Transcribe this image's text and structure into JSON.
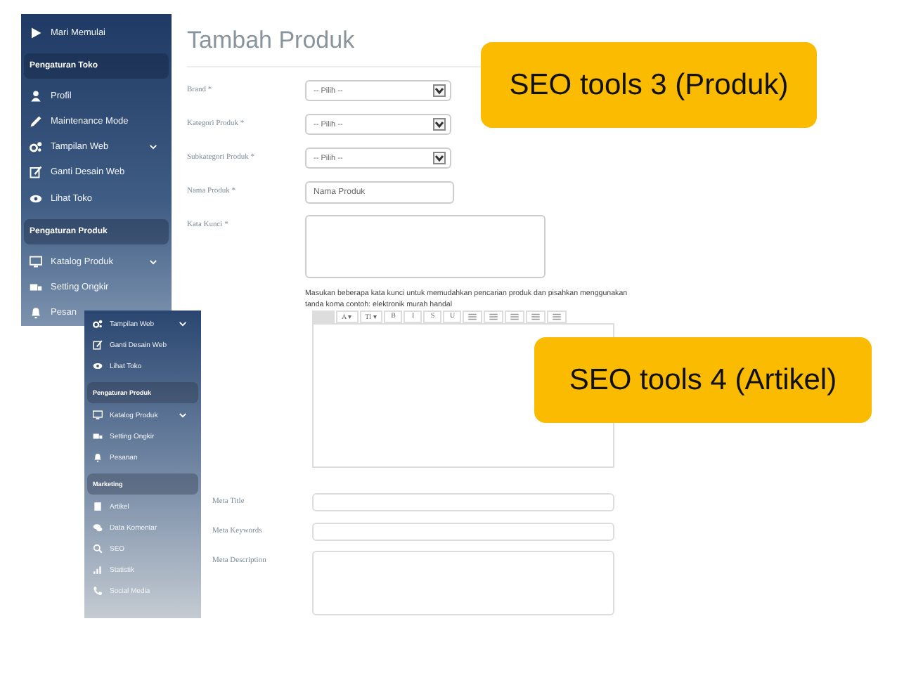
{
  "screens": [
    {
      "sidebar": {
        "items": [
          {
            "kind": "item",
            "label": "Mari Memulai",
            "has_submenu": false
          },
          {
            "kind": "section",
            "label": "Pengaturan Toko"
          },
          {
            "kind": "item",
            "label": "Profil",
            "has_submenu": false
          },
          {
            "kind": "item",
            "label": "Maintenance Mode",
            "has_submenu": false
          },
          {
            "kind": "item",
            "label": "Tampilan Web",
            "has_submenu": true
          },
          {
            "kind": "item",
            "label": "Ganti Desain Web",
            "has_submenu": false
          },
          {
            "kind": "item",
            "label": "Lihat Toko",
            "has_submenu": false
          },
          {
            "kind": "section",
            "label": "Pengaturan Produk"
          },
          {
            "kind": "item",
            "label": "Katalog Produk",
            "has_submenu": true
          },
          {
            "kind": "item",
            "label": "Setting Ongkir",
            "has_submenu": false
          },
          {
            "kind": "item",
            "label": "Pesan",
            "has_submenu": false
          }
        ]
      },
      "form": {
        "title": "Tambah Produk",
        "fields": [
          {
            "kind": "select",
            "label": "Brand *",
            "value": "-- Pilih --"
          },
          {
            "kind": "select",
            "label": "Kategori Produk *",
            "value": "-- Pilih --"
          },
          {
            "kind": "select",
            "label": "Subkategori Produk *",
            "value": "-- Pilih --"
          },
          {
            "kind": "text",
            "label": "Nama Produk *",
            "placeholder": "Nama Produk"
          },
          {
            "kind": "textarea",
            "label": "Kata Kunci *",
            "help": [
              "Masukan beberapa kata kunci untuk memudahkan pencarian produk dan pisahkan menggunakan",
              "tanda koma contoh: elektronik murah handal"
            ]
          }
        ]
      }
    },
    {
      "sidebar": {
        "items": [
          {
            "kind": "item",
            "label": "Tampilan Web",
            "has_submenu": true
          },
          {
            "kind": "item",
            "label": "Ganti Desain Web",
            "has_submenu": false
          },
          {
            "kind": "item",
            "label": "Lihat Toko",
            "has_submenu": false
          },
          {
            "kind": "section",
            "label": "Pengaturan Produk"
          },
          {
            "kind": "item",
            "label": "Katalog Produk",
            "has_submenu": true
          },
          {
            "kind": "item",
            "label": "Setting Ongkir",
            "has_submenu": false
          },
          {
            "kind": "item",
            "label": "Pesanan",
            "has_submenu": false
          },
          {
            "kind": "section",
            "label": "Marketing"
          },
          {
            "kind": "item",
            "label": "Artikel",
            "has_submenu": false
          },
          {
            "kind": "item",
            "label": "Data Komentar",
            "has_submenu": false
          },
          {
            "kind": "item",
            "label": "SEO",
            "has_submenu": false
          },
          {
            "kind": "item",
            "label": "Statistik",
            "has_submenu": false
          },
          {
            "kind": "item",
            "label": "Social Media",
            "has_submenu": false
          }
        ]
      },
      "form": {
        "toolbar": [
          {
            "kind": "blank"
          },
          {
            "kind": "text",
            "label": "A ▾"
          },
          {
            "kind": "text",
            "label": "Tl ▾"
          },
          {
            "kind": "text",
            "label": "B"
          },
          {
            "kind": "text",
            "label": "I"
          },
          {
            "kind": "text",
            "label": "S"
          },
          {
            "kind": "text",
            "label": "U"
          },
          {
            "kind": "icon"
          },
          {
            "kind": "icon"
          },
          {
            "kind": "icon"
          },
          {
            "kind": "icon"
          },
          {
            "kind": "icon"
          }
        ],
        "fields": [
          {
            "kind": "editor"
          },
          {
            "kind": "text",
            "label": "Meta Title"
          },
          {
            "kind": "text",
            "label": "Meta Keywords"
          },
          {
            "kind": "textarea",
            "label": "Meta Description"
          }
        ]
      }
    }
  ],
  "callouts": [
    {
      "text": "SEO tools 3 (Produk)"
    },
    {
      "text": "SEO tools 4 (Artikel)"
    }
  ]
}
